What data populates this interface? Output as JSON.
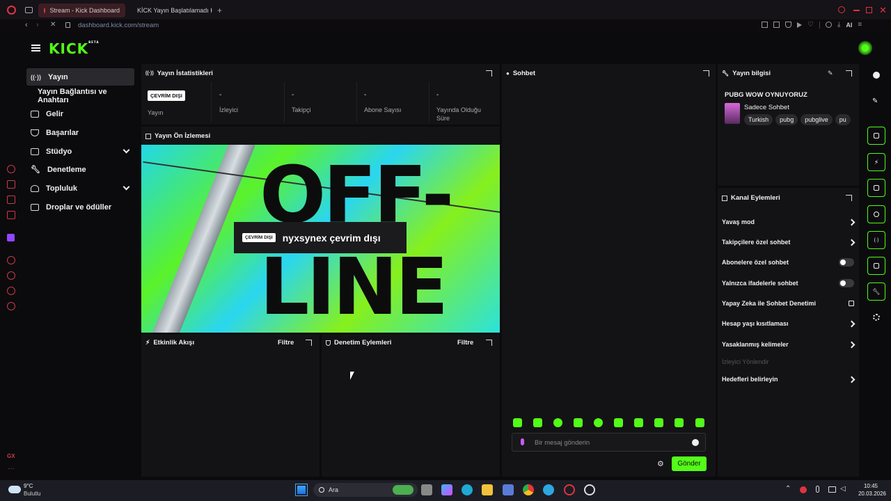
{
  "browser": {
    "tabs": [
      {
        "label": "Stream - Kick Dashboard",
        "active": true
      },
      {
        "label": "KİCK Yayın Başlatılamadı Hatas"
      }
    ],
    "url_host": "dashboard.kick.com",
    "url_path": "/stream",
    "ai_label": "AI",
    "gx_label": "GX"
  },
  "kick": {
    "logo": "KICK",
    "beta": "BETA"
  },
  "sidebar": {
    "items": [
      {
        "label": "Yayın",
        "icon": "broadcast-icon",
        "active": true
      },
      {
        "label": "Yayın Bağlantısı ve Anahtarı",
        "icon": ""
      },
      {
        "label": "Gelir",
        "icon": "chart-icon"
      },
      {
        "label": "Başarılar",
        "icon": "trophy-icon"
      },
      {
        "label": "Stüdyo",
        "icon": "studio-icon",
        "expandable": true
      },
      {
        "label": "Denetleme",
        "icon": "wrench-icon"
      },
      {
        "label": "Topluluk",
        "icon": "users-icon",
        "expandable": true
      },
      {
        "label": "Droplar ve ödüller",
        "icon": "gift-icon"
      }
    ]
  },
  "stats": {
    "title": "Yayın İstatistikleri",
    "status_badge": "ÇEVRİM DIŞI",
    "cells": [
      {
        "value": "",
        "label": "Yayın"
      },
      {
        "value": "-",
        "label": "İzleyici"
      },
      {
        "value": "-",
        "label": "Takipçi"
      },
      {
        "value": "-",
        "label": "Abone Sayısı"
      },
      {
        "value": "-",
        "label": "Yayında Olduğu Süre"
      }
    ]
  },
  "preview": {
    "title": "Yayın Ön İzlemesi",
    "offline_badge": "ÇEVRİM DIŞI",
    "offline_text": "nyxsynex çevrim dışı",
    "bg_big_text_1": "OFF-",
    "bg_big_text_2": "LINE"
  },
  "activity": {
    "title": "Etkinlik Akışı",
    "filter": "Filtre"
  },
  "moderation": {
    "title": "Denetim Eylemleri",
    "filter": "Filtre"
  },
  "chat": {
    "title": "Sohbet",
    "placeholder": "Bir mesaj gönderin",
    "send": "Gönder",
    "emote_count": 10
  },
  "stream_info": {
    "title": "Yayın bilgisi",
    "stream_title": "PUBG WOW OYNUYORUZ",
    "category": "Sadece Sohbet",
    "tags": [
      "Turkish",
      "pubg",
      "pubglive",
      "pu"
    ]
  },
  "channel_actions": {
    "title": "Kanal Eylemleri",
    "items": [
      {
        "label": "Yavaş mod",
        "control": "chevron"
      },
      {
        "label": "Takipçilere özel sohbet",
        "control": "chevron"
      },
      {
        "label": "Abonelere özel sohbet",
        "control": "toggle",
        "on": false
      },
      {
        "label": "Yalnızca ifadelerle sohbet",
        "control": "toggle",
        "on": false
      },
      {
        "label": "Yapay Zeka ile Sohbet Denetimi",
        "control": "external"
      },
      {
        "label": "Hesap yaşı kısıtlaması",
        "control": "chevron"
      },
      {
        "label": "Yasaklanmış kelimeler",
        "control": "chevron"
      },
      {
        "label": "İzleyici Yönlendir",
        "control": "none",
        "disabled": true
      },
      {
        "label": "Hedefleri belirleyin",
        "control": "chevron"
      }
    ]
  },
  "taskbar": {
    "weather_temp": "9°C",
    "weather_desc": "Bulutlu",
    "search": "Ara",
    "time": "10:45",
    "date": "20.03.2026"
  },
  "colors": {
    "accent": "#53fc18",
    "opera": "#e0343f",
    "panel": "#131316"
  }
}
